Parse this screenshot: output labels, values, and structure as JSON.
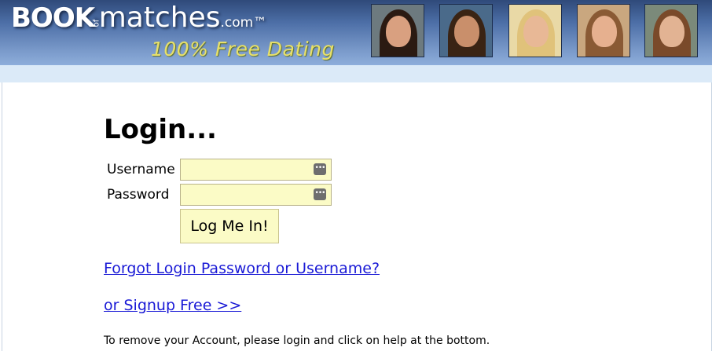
{
  "header": {
    "logo": {
      "book": "BOOK",
      "of": "of",
      "matches": "matches",
      "com": ".com™"
    },
    "tagline": "100% Free Dating",
    "photos": [
      {
        "name": "profile-photo-1",
        "bg": "#6d7a7f",
        "hair": "#2b1a12",
        "skin": "#d9a080"
      },
      {
        "name": "profile-photo-2",
        "bg": "#4a6a8a",
        "hair": "#3a2414",
        "skin": "#c98f6b"
      },
      {
        "name": "profile-photo-3",
        "bg": "#e9d9a6",
        "hair": "#e0c27a",
        "skin": "#e8b896"
      },
      {
        "name": "profile-photo-4",
        "bg": "#c9a77f",
        "hair": "#8a5a34",
        "skin": "#e6b08f"
      },
      {
        "name": "profile-photo-5",
        "bg": "#7b8a7a",
        "hair": "#7a4a2a",
        "skin": "#e2b393"
      }
    ]
  },
  "login": {
    "title": "Login...",
    "username_label": "Username",
    "username_value": "",
    "password_label": "Password",
    "password_value": "",
    "submit_label": "Log Me In!"
  },
  "links": {
    "forgot": "Forgot Login Password or Username?",
    "signup": "or Signup Free >>"
  },
  "footer_note": "To remove your Account, please login and click on help at the bottom.",
  "colors": {
    "header_blue": "#4d6fa7",
    "tagline_yellow": "#e7e06a",
    "input_bg": "#fbfbc6",
    "link_blue": "#1a1ad6"
  }
}
